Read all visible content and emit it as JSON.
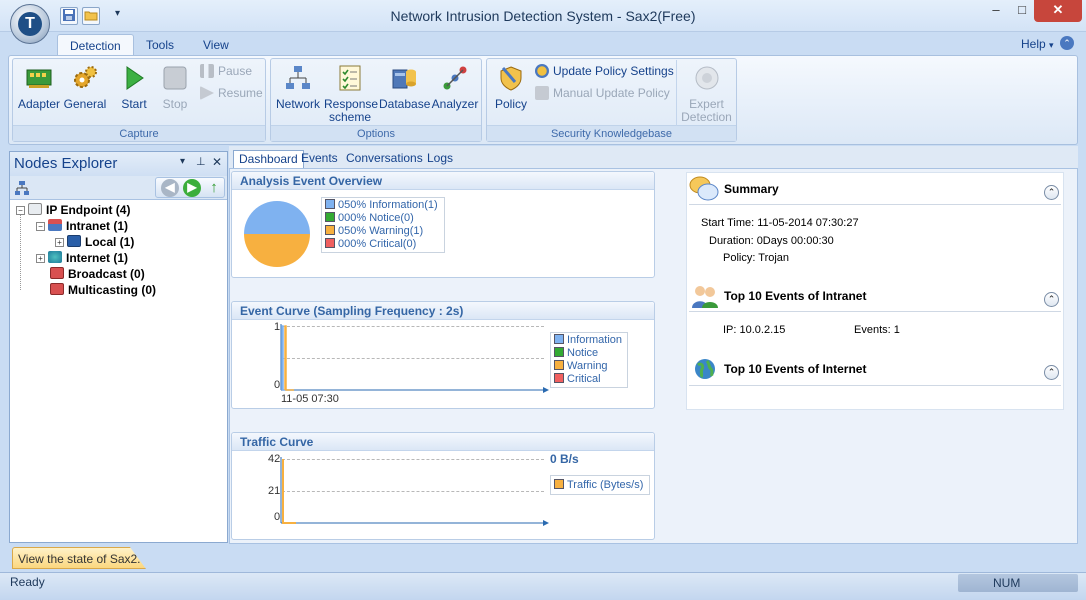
{
  "window": {
    "title": "Network Intrusion Detection System - Sax2(Free)",
    "minimize": "–",
    "maximize": "□",
    "close": "✕",
    "app_logo": "T",
    "qat_menu": "▾"
  },
  "ribbon": {
    "tabs": [
      "Detection",
      "Tools",
      "View"
    ],
    "help": "Help",
    "help_chevron": "▾",
    "help_arrow": "⌃",
    "groups": {
      "capture": {
        "title": "Capture",
        "adapter": "Adapter",
        "general": "General",
        "start": "Start",
        "stop": "Stop",
        "pause": "Pause",
        "resume": "Resume"
      },
      "options": {
        "title": "Options",
        "network": "Network",
        "response_line1": "Response",
        "response_line2": "scheme",
        "database": "Database",
        "analyzer": "Analyzer"
      },
      "knowledgebase": {
        "title": "Security Knowledgebase",
        "policy": "Policy",
        "update_policy_settings": "Update Policy Settings",
        "manual_update_policy": "Manual Update Policy",
        "expert_line1": "Expert",
        "expert_line2": "Detection"
      }
    }
  },
  "nodes_explorer": {
    "title": "Nodes Explorer",
    "controls": {
      "menu": "▾",
      "pin": "⊥",
      "close": "✕"
    },
    "nav": {
      "back": "◀",
      "forward": "▶",
      "up": "↑"
    },
    "tree": [
      {
        "label": "IP Endpoint (4)",
        "expander": "−"
      },
      {
        "label": "Intranet (1)",
        "expander": "−"
      },
      {
        "label": "Local (1)",
        "expander": "+"
      },
      {
        "label": "Internet (1)",
        "expander": "+"
      },
      {
        "label": "Broadcast (0)",
        "expander": ""
      },
      {
        "label": "Multicasting (0)",
        "expander": ""
      }
    ]
  },
  "main_tabs": [
    "Dashboard",
    "Events",
    "Conversations",
    "Logs"
  ],
  "dashboard": {
    "overview": {
      "title": "Analysis Event Overview",
      "legend": [
        {
          "text": "050% Information(1)",
          "color": "#7fb2f0"
        },
        {
          "text": "000% Notice(0)",
          "color": "#33aa33"
        },
        {
          "text": "050% Warning(1)",
          "color": "#f7b040"
        },
        {
          "text": "000% Critical(0)",
          "color": "#f06060"
        }
      ]
    },
    "event_curve": {
      "title": "Event Curve (Sampling Frequency : 2s)",
      "y_top": "1",
      "y_bottom": "0",
      "x_label": "11-05 07:30",
      "legend": [
        {
          "text": "Information",
          "color": "#7fb2f0"
        },
        {
          "text": "Notice",
          "color": "#33aa33"
        },
        {
          "text": "Warning",
          "color": "#f7b040"
        },
        {
          "text": "Critical",
          "color": "#f06060"
        }
      ]
    },
    "traffic_curve": {
      "title": "Traffic Curve",
      "y_top": "42",
      "y_mid": "21",
      "y_bottom": "0",
      "rate": "0 B/s",
      "legend": [
        {
          "text": "Traffic (Bytes/s)",
          "color": "#f7b040"
        }
      ]
    }
  },
  "chart_data": [
    {
      "type": "pie",
      "title": "Analysis Event Overview",
      "categories": [
        "Information",
        "Notice",
        "Warning",
        "Critical"
      ],
      "values": [
        1,
        0,
        1,
        0
      ],
      "colors": [
        "#7fb2f0",
        "#33aa33",
        "#f7b040",
        "#f06060"
      ]
    },
    {
      "type": "line",
      "title": "Event Curve (Sampling Frequency : 2s)",
      "x": [
        "11-05 07:30"
      ],
      "ylim": [
        0,
        1
      ],
      "series": [
        {
          "name": "Information",
          "values": [
            1
          ]
        },
        {
          "name": "Notice",
          "values": [
            0
          ]
        },
        {
          "name": "Warning",
          "values": [
            1
          ]
        },
        {
          "name": "Critical",
          "values": [
            0
          ]
        }
      ]
    },
    {
      "type": "line",
      "title": "Traffic Curve",
      "ylim": [
        0,
        42
      ],
      "yticks": [
        0,
        21,
        42
      ],
      "series": [
        {
          "name": "Traffic (Bytes/s)",
          "values": [
            42,
            0
          ]
        }
      ]
    }
  ],
  "summary": {
    "title": "Summary",
    "collapse": "⌃",
    "start_time": "Start Time: 11-05-2014 07:30:27",
    "duration": "Duration: 0Days   00:00:30",
    "policy": "Policy: Trojan",
    "intranet_title": "Top 10 Events of Intranet",
    "intranet_ip": "IP:  10.0.2.15",
    "intranet_events": "Events:  1",
    "internet_title": "Top 10 Events of Internet"
  },
  "status": {
    "tab_text": "View the state of Sax2.",
    "ready": "Ready",
    "num": "NUM"
  }
}
